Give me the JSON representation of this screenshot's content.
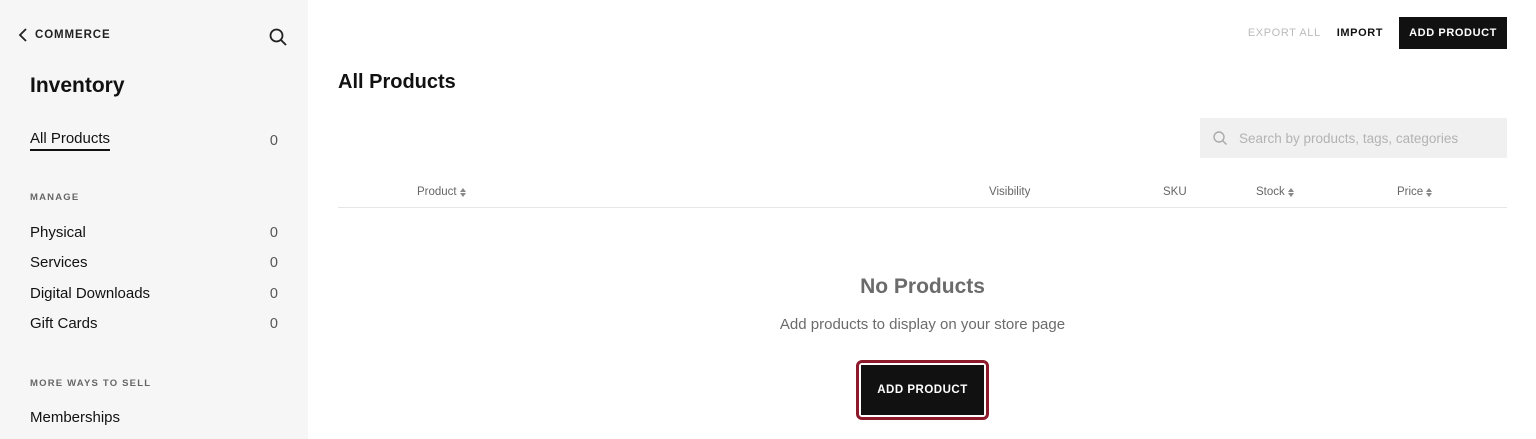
{
  "sidebar": {
    "back_label": "COMMERCE",
    "title": "Inventory",
    "all_products": {
      "label": "All Products",
      "count": "0"
    },
    "manage_heading": "MANAGE",
    "manage_items": [
      {
        "label": "Physical",
        "count": "0"
      },
      {
        "label": "Services",
        "count": "0"
      },
      {
        "label": "Digital Downloads",
        "count": "0"
      },
      {
        "label": "Gift Cards",
        "count": "0"
      }
    ],
    "more_heading": "MORE WAYS TO SELL",
    "more_items": [
      {
        "label": "Memberships"
      }
    ]
  },
  "toolbar": {
    "export_label": "EXPORT ALL",
    "import_label": "IMPORT",
    "add_label": "ADD PRODUCT"
  },
  "main": {
    "title": "All Products",
    "search_placeholder": "Search by products, tags, categories",
    "columns": [
      "Product",
      "Visibility",
      "SKU",
      "Stock",
      "Price"
    ],
    "empty_title": "No Products",
    "empty_subtitle": "Add products to display on your store page",
    "add_button_label": "ADD PRODUCT"
  },
  "colors": {
    "sidebar_bg": "#f6f6f6",
    "primary_button": "#111111",
    "focus_ring": "#8c1a2a"
  }
}
